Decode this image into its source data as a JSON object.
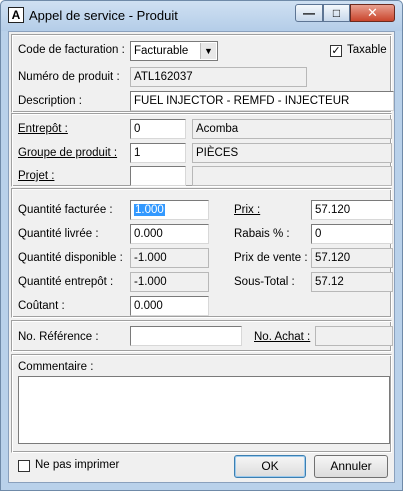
{
  "window": {
    "title": "Appel de service - Produit",
    "icon_glyph": "A",
    "min_glyph": "—",
    "max_glyph": "□",
    "close_glyph": "✕"
  },
  "billing": {
    "label": "Code de facturation :",
    "value": "Facturable",
    "taxable_label": "Taxable",
    "taxable_checked": "✓"
  },
  "product": {
    "number_label": "Numéro de produit :",
    "number_value": "ATL162037",
    "description_label": "Description :",
    "description_value": "FUEL INJECTOR - REMFD - INJECTEUR"
  },
  "location": {
    "warehouse_label": "Entrepôt :",
    "warehouse_code": "0",
    "warehouse_name": "Acomba",
    "group_label": "Groupe de produit :",
    "group_code": "1",
    "group_name": "PIÈCES",
    "project_label": "Projet :",
    "project_code": "",
    "project_name": ""
  },
  "quantities": {
    "billed_label": "Quantité facturée :",
    "billed_value": "1.000",
    "delivered_label": "Quantité livrée :",
    "delivered_value": "0.000",
    "available_label": "Quantité disponible :",
    "available_value": "-1.000",
    "warehouse_label": "Quantité entrepôt :",
    "warehouse_value": "-1.000",
    "cost_label": "Coûtant :",
    "cost_value": "0.000"
  },
  "pricing": {
    "price_label": "Prix :",
    "price_value": "57.120",
    "discount_label": "Rabais % :",
    "discount_value": "0",
    "sale_price_label": "Prix de vente :",
    "sale_price_value": "57.120",
    "subtotal_label": "Sous-Total :",
    "subtotal_value": "57.12"
  },
  "reference": {
    "ref_label": "No. Référence :",
    "ref_value": "",
    "purchase_label": "No. Achat :",
    "purchase_value": ""
  },
  "comment": {
    "label": "Commentaire :",
    "value": ""
  },
  "footer": {
    "no_print_label": "Ne pas imprimer",
    "ok_label": "OK",
    "cancel_label": "Annuler"
  }
}
